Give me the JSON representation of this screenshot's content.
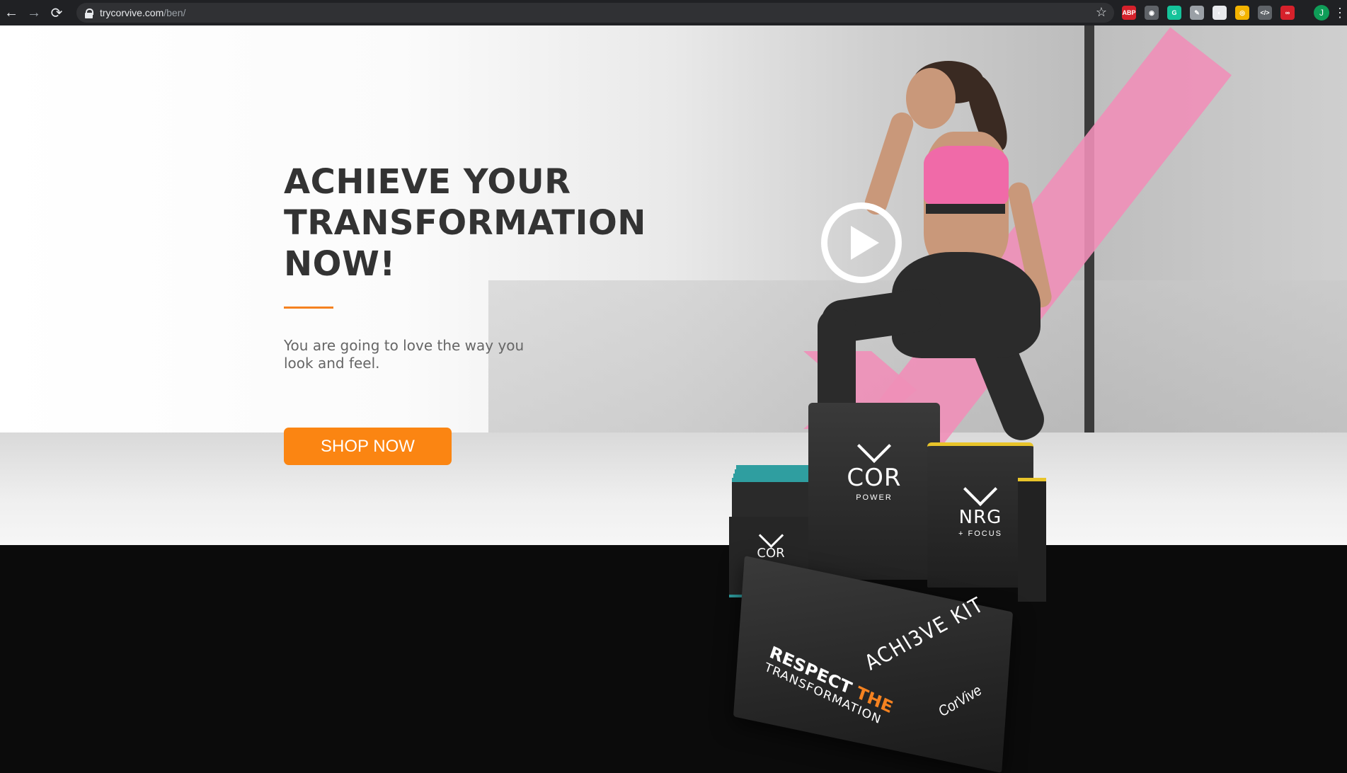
{
  "browser": {
    "url_host": "trycorvive.com",
    "url_path": "/ben/",
    "back_icon": "←",
    "forward_icon": "→",
    "reload_icon": "⟳",
    "star_icon": "☆",
    "avatar_initial": "J",
    "menu_icon": "⋮",
    "extensions": [
      {
        "name": "adblock-plus-icon",
        "label": "ABP",
        "color": "#d6212b"
      },
      {
        "name": "camera-icon",
        "label": "◉",
        "color": "#5f6368"
      },
      {
        "name": "grammarly-icon",
        "label": "G",
        "color": "#15c39a"
      },
      {
        "name": "pin-icon",
        "label": "✎",
        "color": "#9aa0a6"
      },
      {
        "name": "color-picker-icon",
        "label": "◐",
        "color": "#e8eaed"
      },
      {
        "name": "chrome-ext-icon",
        "label": "◎",
        "color": "#f4b400"
      },
      {
        "name": "code-icon",
        "label": "</>",
        "color": "#5f6368"
      },
      {
        "name": "lastpass-icon",
        "label": "∞",
        "color": "#d6212b"
      }
    ]
  },
  "hero": {
    "headline": [
      "ACHIEVE YOUR",
      "TRANSFORMATION",
      "NOW!"
    ],
    "subtext": "You are going to love the way you look and feel.",
    "cta_label": "SHOP NOW",
    "accent_color": "#f58220",
    "cta_color": "#fb8512"
  },
  "products": {
    "sachet_name": "COR",
    "cor_bag_name": "COR",
    "cor_bag_sub": "POWER",
    "nrg_bag_name": "NRG",
    "nrg_bag_sub": "+ FOCUS",
    "box_kit": "ACHI3VE KIT",
    "box_respect": "RESPECT",
    "box_the": "THE",
    "box_transformation": "TRANSFORMATION",
    "box_brand": "CorVive"
  }
}
